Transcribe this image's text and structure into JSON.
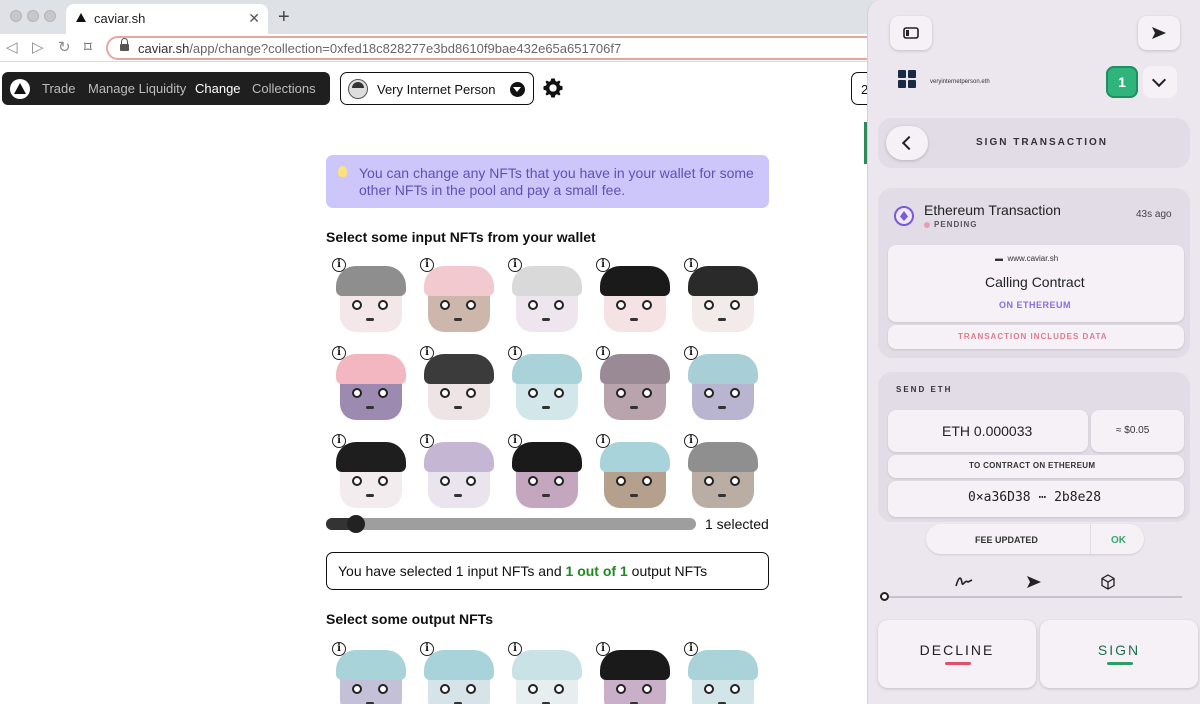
{
  "browser": {
    "tab_title": "caviar.sh",
    "url_domain": "caviar.sh",
    "url_path": "/app/change?collection=0xfed18c828277e3bd8610f9bae432e65a651706f7"
  },
  "nav": {
    "links": [
      "Trade",
      "Manage Liquidity",
      "Change",
      "Collections"
    ],
    "active": "Change",
    "collection_name": "Very Internet Person",
    "peek_text": "2"
  },
  "info": {
    "text": "You can change any NFTs that you have in your wallet for some other NFTs in the pool and pay a small fee."
  },
  "input_section": {
    "title": "Select some input NFTs from your wallet",
    "nfts": [
      {
        "hair": "#8e8e8e",
        "skin": "#f3e7ea"
      },
      {
        "hair": "#f1c9cf",
        "skin": "#cdb7ad"
      },
      {
        "hair": "#d9d9d9",
        "skin": "#efe5ee"
      },
      {
        "hair": "#1a1a1a",
        "skin": "#f4e2e5"
      },
      {
        "hair": "#2a2a2a",
        "skin": "#f3eaea"
      },
      {
        "hair": "#f2b7c0",
        "skin": "#9d8ab0"
      },
      {
        "hair": "#3b3b3b",
        "skin": "#efe4e5"
      },
      {
        "hair": "#a9d3d9",
        "skin": "#d2e7ea"
      },
      {
        "hair": "#9a8a96",
        "skin": "#b9a3ad"
      },
      {
        "hair": "#a8cfd6",
        "skin": "#b9b4cf"
      },
      {
        "hair": "#1e1e1e",
        "skin": "#f2ecee"
      },
      {
        "hair": "#c5b7d3",
        "skin": "#eae4ee"
      },
      {
        "hair": "#1a1a1a",
        "skin": "#c4a6bf"
      },
      {
        "hair": "#a8d3da",
        "skin": "#b59f8d"
      },
      {
        "hair": "#8f8f8f",
        "skin": "#b9ada4"
      }
    ]
  },
  "slider": {
    "value": 1,
    "max": 15,
    "label": "1 selected"
  },
  "selection": {
    "prefix": "You have selected 1 input NFTs and ",
    "highlight": "1 out of 1",
    "suffix": " output NFTs"
  },
  "output_section": {
    "title": "Select some output NFTs",
    "nfts": [
      {
        "hair": "#a7d3d9",
        "skin": "#c4c0d8"
      },
      {
        "hair": "#a8d3da",
        "skin": "#d6e3e8"
      },
      {
        "hair": "#c9e2e5",
        "skin": "#e6eef0"
      },
      {
        "hair": "#1a1a1a",
        "skin": "#c9b0c8"
      },
      {
        "hair": "#a9d3d9",
        "skin": "#d2e5e8"
      }
    ]
  },
  "wallet": {
    "account_name": "veryinternetperson.eth",
    "badge_count": "1",
    "header_title": "SIGN TRANSACTION",
    "tx_title": "Ethereum Transaction",
    "tx_status": "PENDING",
    "tx_time": "43s ago",
    "origin": "www.caviar.sh",
    "action": "Calling Contract",
    "network": "ON ETHEREUM",
    "data_note": "TRANSACTION INCLUDES DATA",
    "send_title": "SEND ETH",
    "amount": "ETH 0.000033",
    "fiat": "≈ $0.05",
    "to_label": "TO CONTRACT ON ETHEREUM",
    "address": "0×a36D38 ⋯ 2b8e28",
    "fee_label": "FEE UPDATED",
    "fee_ok": "OK",
    "decline_label": "DECLINE",
    "sign_label": "SIGN",
    "colors": {
      "accent_purple": "#8a6de0",
      "decline_bar": "#e0506a",
      "sign_bar": "#2e9d6a",
      "badge_green": "#2fb57c"
    }
  }
}
